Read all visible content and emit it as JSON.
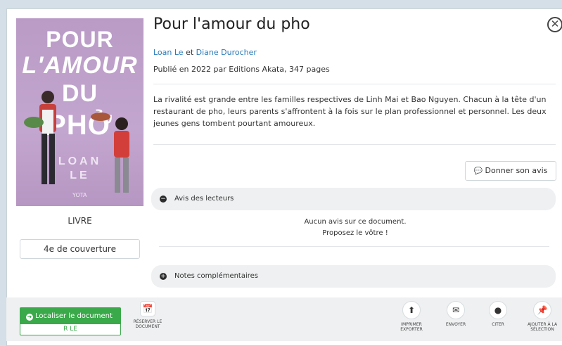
{
  "book": {
    "title": "Pour l'amour du pho",
    "authors_sep": " et ",
    "author1": "Loan Le",
    "author2": "Diane Durocher",
    "publication": "Publié en 2022 par Editions Akata, 347 pages",
    "summary": "La rivalité est grande entre les familles respectives de Linh Mai et Bao Nguyen. Chacun à la tête d'un restaurant de pho, leurs parents s'affrontent à la fois sur le plan professionnel et personnel. Les deux jeunes gens tombent pourtant amoureux."
  },
  "cover": {
    "line1": "POUR",
    "line2": "L'AMOUR",
    "line3": "DU",
    "line4": "PHỞ",
    "author_line1": "LOAN",
    "author_line2": "LE",
    "publisher_mark": "YOTA"
  },
  "doc_type": "LIVRE",
  "back_cover_button": "4e de couverture",
  "review_button": "Donner son avis",
  "sections": {
    "reviews": "Avis des lecteurs",
    "no_review_1": "Aucun avis sur ce document.",
    "no_review_2": "Proposez le vôtre !",
    "notes": "Notes complémentaires"
  },
  "locate": {
    "label": "Localiser le document",
    "cote": "R LE"
  },
  "actions": {
    "reserve": "Réserver le document",
    "print": "Imprimer exporter",
    "send": "Envoyer",
    "cite": "Citer",
    "add": "Ajouter à la sélection"
  },
  "icons": {
    "close": "close-icon",
    "comment": "comment-icon",
    "calendar": "calendar-icon",
    "upload": "upload-icon",
    "envelope": "envelope-icon",
    "pin": "pin-icon"
  },
  "colors": {
    "link": "#2b7bb9",
    "accent_green": "#3aa94a",
    "cover_bg": "#c3a6cf",
    "page_bg": "#d4dfe7"
  }
}
